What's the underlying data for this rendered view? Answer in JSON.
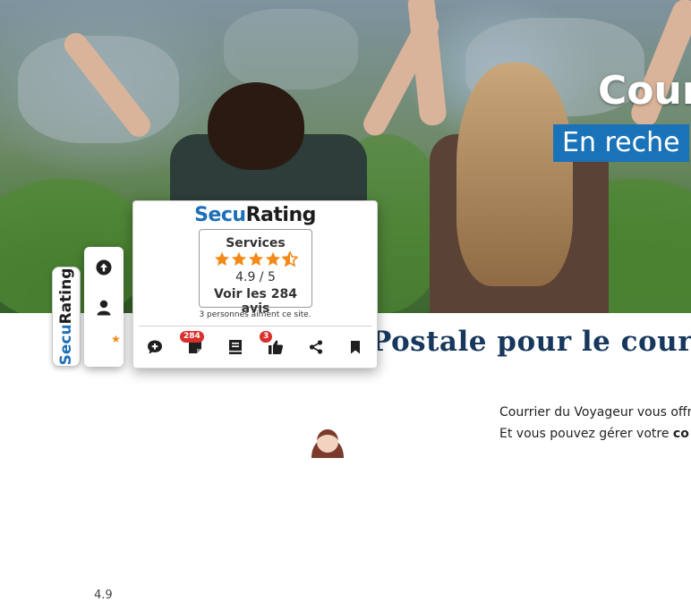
{
  "hero": {
    "title": "Cour",
    "subtitle": "En reche"
  },
  "page": {
    "heading": "Postale pour le cour",
    "paragraph_1": "Courrier du Voyageur vous offr",
    "paragraph_2_start": "Et vous pouvez gérer votre ",
    "paragraph_2_bold": "co"
  },
  "securating_tab": {
    "logo_part1": "Secu",
    "logo_part2": "Rating"
  },
  "side_panel": {
    "scroll_top_icon": "arrow-up-circle-icon",
    "account_icon": "user-icon",
    "rating": "4.9",
    "star_color": "#f28a1a"
  },
  "widget": {
    "logo_part1": "Secu",
    "logo_part2": "Rating",
    "category": "Services",
    "stars_full": 4,
    "stars_half": 1,
    "star_color": "#f28a1a",
    "score_text": "4.9 / 5",
    "reviews_link": "Voir les 284 avis",
    "likes_text": "3 personnes aiment ce site.",
    "actions": [
      {
        "icon": "comment-add-icon"
      },
      {
        "icon": "note-icon",
        "badge": "284"
      },
      {
        "icon": "book-icon"
      },
      {
        "icon": "thumbs-up-icon",
        "badge": "3"
      },
      {
        "icon": "share-icon"
      },
      {
        "icon": "bookmark-icon"
      }
    ],
    "badge_color": "#d9302c",
    "brand_blue": "#1d6fb8"
  }
}
